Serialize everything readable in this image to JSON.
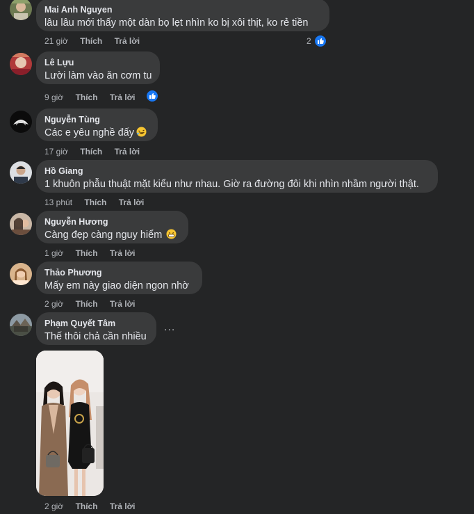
{
  "labels": {
    "like": "Thích",
    "reply": "Trả lời",
    "more": "..."
  },
  "comments": [
    {
      "author": "Mai Anh Nguyen",
      "text": "lâu lâu mới thấy một dàn bọ lẹt nhìn ko bị xôi thịt, ko rẻ tiền",
      "time": "21 giờ",
      "reactions": "2"
    },
    {
      "author": "Lê Lựu",
      "text": "Lười làm vào ăn cơm tu",
      "time": "9 giờ"
    },
    {
      "author": "Nguyễn Tùng",
      "text": "Các e yêu nghề đấy",
      "time": "17 giờ",
      "emoji": "rolling-laughing-emoji"
    },
    {
      "author": "Hồ Giang",
      "text": "1 khuôn phẫu thuật mặt kiểu như nhau. Giờ ra đường đôi khi nhìn nhầm người thật.",
      "time": "13 phút"
    },
    {
      "author": "Nguyễn Hương",
      "text": "Càng đẹp càng nguy hiểm",
      "time": "1 giờ",
      "emoji": "grinning-emoji"
    },
    {
      "author": "Thảo Phương",
      "text": "Mấy em này giao diện ngon nhờ",
      "time": "2 giờ"
    },
    {
      "author": "Phạm Quyết Tâm",
      "text": "Thế thôi chả cần nhiều",
      "time": "2 giờ",
      "attachment": "photo of two women in dresses holding handbags"
    }
  ],
  "colors": {
    "background": "#242526",
    "bubble": "#3a3b3c",
    "text": "#e4e6eb",
    "secondary": "#b0b3b8",
    "like_blue": "#1877f2"
  }
}
